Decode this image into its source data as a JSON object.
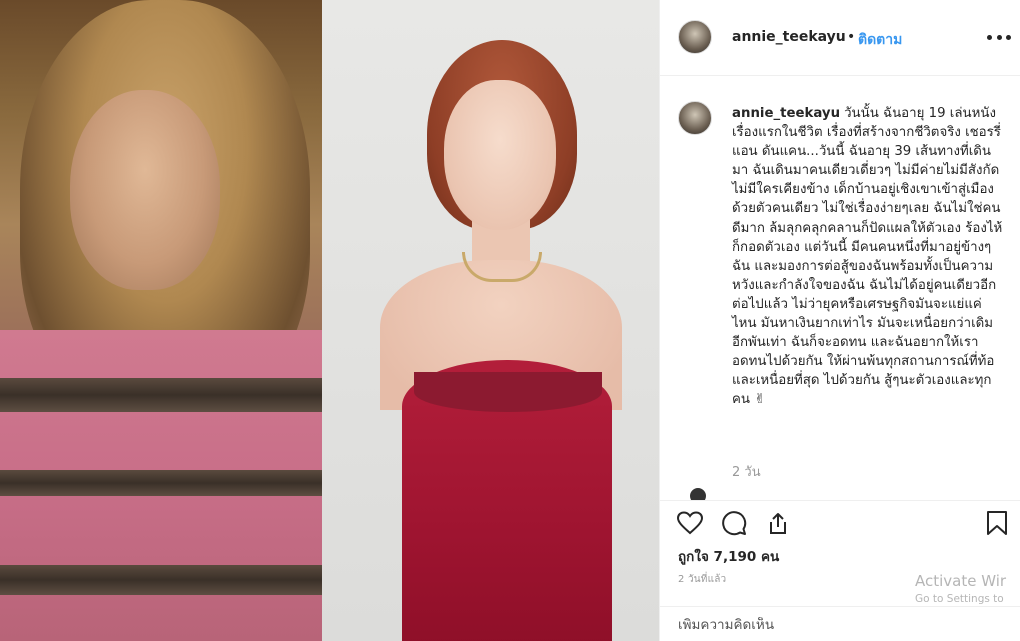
{
  "post": {
    "username": "annie_teekayu",
    "separator": "•",
    "follow_label": "ติดตาม",
    "caption_text": "วันนั้น ฉันอายุ 19 เล่นหนังเรื่องแรกในชีวิต เรื่องที่สร้างจากชีวิตจริง เชอรรี่ แอน ดันแคน...วันนี้ ฉันอายุ 39 เส้นทางที่เดินมา ฉันเดินมาคนเดียวเดี่ยวๆ ไม่มีค่ายไม่มีสังกัดไม่มีใครเคียงข้าง เด็กบ้านอยู่เชิงเขาเข้าสู่เมืองด้วยตัวคนเดียว ไม่ใช่เรื่องง่ายๆเลย ฉันไม่ใช่คนดีมาก ล้มลุกคลุกคลานก็ปัดแผลให้ตัวเอง ร้องไห้ก็กอดตัวเอง แต่วันนี้ มีคนคนหนึ่งที่มาอยู่ข้างๆฉัน และมองการต่อสู้ของฉันพร้อมทั้งเป็นความหวังและกำลังใจของฉัน ฉันไม่ได้อยู่คนเดียวอีกต่อไปแล้ว ไม่ว่ายุคหรือเศรษฐกิจมันจะแย่แค่ไหน มันหาเงินยากเท่าไร มันจะเหนื่อยกว่าเดิมอีกพันเท่า ฉันก็จะอดทน และฉันอยากให้เราอดทนไปด้วยกัน ให้ผ่านพ้นทุกสถานการณ์ที่ท้อและเหนื่อยที่สุด ไปด้วยกัน สู้ๆนะตัวเองและทุกคน ✌",
    "comment_time": "2 วัน",
    "likes_text": "ถูกใจ 7,190 คน",
    "timestamp": "2 วันที่แล้ว",
    "add_comment_placeholder": "เพิ่มความคิดเห็น"
  },
  "watermark": {
    "line1": "Activate Wir",
    "line2": "Go to Settings to"
  },
  "icons": {
    "like": "heart-icon",
    "comment": "comment-icon",
    "share": "share-icon",
    "save": "bookmark-icon",
    "more": "more-icon"
  },
  "colors": {
    "follow": "#3897f0",
    "text": "#262626",
    "muted": "#999999",
    "border": "#efefef"
  }
}
